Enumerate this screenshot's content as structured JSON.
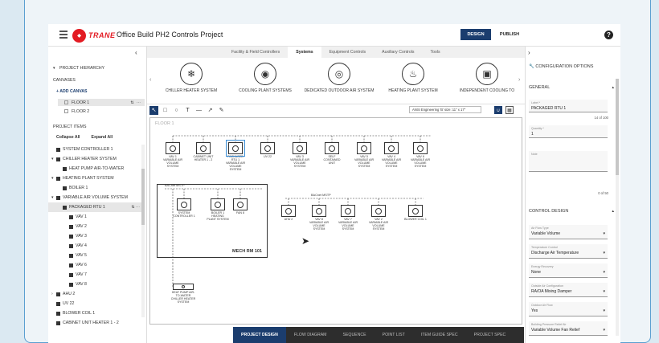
{
  "topbar": {
    "brand": "TRANE",
    "project_title": "Office Build PH2 Controls Project",
    "design_label": "DESIGN",
    "publish_label": "PUBLISH",
    "help_glyph": "?"
  },
  "left": {
    "hierarchy_title": "PROJECT HIERARCHY",
    "canvases_title": "CANVASES",
    "add_canvas": "+ ADD CANVAS",
    "canvases": [
      "FLOOR 1",
      "FLOOR 2"
    ],
    "project_items_title": "PROJECT ITEMS",
    "collapse_all": "Collapse All",
    "expand_all": "Expand All",
    "tree": [
      {
        "label": "SYSTEM CONTROLLER 1",
        "level": 1,
        "toggle": ""
      },
      {
        "label": "CHILLER HEATER SYSTEM",
        "level": 1,
        "toggle": "▾"
      },
      {
        "label": "HEAT PUMP AIR-TO-WATER",
        "level": 2,
        "toggle": ""
      },
      {
        "label": "HEATING PLANT SYSTEM",
        "level": 1,
        "toggle": "▾"
      },
      {
        "label": "BOILER 1",
        "level": 2,
        "toggle": ""
      },
      {
        "label": "VARIABLE AIR VOLUME SYSTEM",
        "level": 1,
        "toggle": "▾"
      },
      {
        "label": "PACKAGED RTU 1",
        "level": 2,
        "toggle": "",
        "selected": true
      },
      {
        "label": "VAV 1",
        "level": 3,
        "toggle": ""
      },
      {
        "label": "VAV 2",
        "level": 3,
        "toggle": ""
      },
      {
        "label": "VAV 3",
        "level": 3,
        "toggle": ""
      },
      {
        "label": "VAV 4",
        "level": 3,
        "toggle": ""
      },
      {
        "label": "VAV 5",
        "level": 3,
        "toggle": ""
      },
      {
        "label": "VAV 6",
        "level": 3,
        "toggle": ""
      },
      {
        "label": "VAV 7",
        "level": 3,
        "toggle": ""
      },
      {
        "label": "VAV 8",
        "level": 3,
        "toggle": ""
      },
      {
        "label": "AHU 2",
        "level": 1,
        "toggle": "›"
      },
      {
        "label": "UV 22",
        "level": 1,
        "toggle": ""
      },
      {
        "label": "BLOWER COIL 1",
        "level": 1,
        "toggle": ""
      },
      {
        "label": "CABINET UNIT HEATER 1 - 2",
        "level": 1,
        "toggle": ""
      }
    ]
  },
  "center": {
    "tabs": [
      {
        "label": "Facility & Field Controllers",
        "active": false
      },
      {
        "label": "Systems",
        "active": true
      },
      {
        "label": "Equipment Controls",
        "active": false
      },
      {
        "label": "Auxiliary Controls",
        "active": false
      },
      {
        "label": "Tools",
        "active": false
      }
    ],
    "catalog": [
      {
        "label": "CHILLER HEATER SYSTEM",
        "glyph": "❄"
      },
      {
        "label": "COOLING PLANT SYSTEMS",
        "glyph": "◉"
      },
      {
        "label": "DEDICATED OUTDOOR AIR SYSTEM",
        "glyph": "◎"
      },
      {
        "label": "HEATING PLANT SYSTEM",
        "glyph": "♨"
      },
      {
        "label": "INDEPENDENT COOLING TO",
        "glyph": "▣"
      }
    ],
    "scale_select": "ANSI Engineering 'B' size: 11\" x 17\"",
    "floor_label": "FLOOR 1",
    "top_row_devices": [
      {
        "label": "VAV 1\nVARIABLE AIR VOLUME SYSTEM"
      },
      {
        "label": "CABINET UNIT HEATER 1 - 2"
      },
      {
        "label": "PACKAGED RTU 1\nVARIABLE AIR VOLUME SYSTEM",
        "selected": true
      },
      {
        "label": "UV 22"
      },
      {
        "label": "VAV 3\nVARIABLE AIR VOLUME SYSTEM"
      },
      {
        "label": "SELF CONTAINED UNIT"
      },
      {
        "label": "VAV 5\nVARIABLE AIR VOLUME SYSTEM"
      },
      {
        "label": "VAV 4\nVARIABLE AIR VOLUME SYSTEM"
      },
      {
        "label": "VAV 6\nVARIABLE AIR VOLUME SYSTEM"
      }
    ],
    "mech_devices": [
      {
        "label": "SYSTEM CONTROLLER 1"
      },
      {
        "label": "BOILER 1\nHEATING PLANT SYSTEM"
      },
      {
        "label": "FAN 8"
      }
    ],
    "mid_row_devices": [
      {
        "label": "AHU 2"
      },
      {
        "label": "VAV 8\nVARIABLE AIR VOLUME SYSTEM"
      },
      {
        "label": "VAV 7\nVARIABLE AIR VOLUME SYSTEM"
      },
      {
        "label": "VAV 2\nVARIABLE AIR VOLUME SYSTEM"
      },
      {
        "label": "BLOWER COIL 1"
      }
    ],
    "heat_pump": "HEAT PUMP AIR-TO-WATER\nCHILLER HEATER SYSTEM",
    "mech_room": "MECH RM 101",
    "bacnet_1": "BACnet MSTP",
    "bacnet_2": "BACnet MSTP",
    "bottom_tabs": [
      {
        "label": "PROJECT DESIGN",
        "active": true
      },
      {
        "label": "FLOW DIAGRAM",
        "active": false
      },
      {
        "label": "SEQUENCE",
        "active": false
      },
      {
        "label": "POINT LIST",
        "active": false
      },
      {
        "label": "ITEM GUIDE SPEC",
        "active": false
      },
      {
        "label": "PROJECT SPEC",
        "active": false
      }
    ]
  },
  "right": {
    "title": "CONFIGURATION OPTIONS",
    "general": "GENERAL",
    "label_field": {
      "label": "Label *",
      "value": "PACKAGED RTU 1",
      "count": "14 of 100"
    },
    "quantity_field": {
      "label": "Quantity *",
      "value": "1"
    },
    "note_field": {
      "label": "Note",
      "value": "",
      "count": "0 of 50"
    },
    "control_design": "CONTROL DESIGN",
    "selects": [
      {
        "label": "Air Flow Type",
        "value": "Variable Volume"
      },
      {
        "label": "Temperature Control",
        "value": "Discharge Air Temperature"
      },
      {
        "label": "Energy Recovery",
        "value": "None"
      },
      {
        "label": "Outside Air Configuration",
        "value": "RA/OA Mixing Damper"
      },
      {
        "label": "Outdoor Air Flow",
        "value": "Yes"
      },
      {
        "label": "Building Pressure Relief Air",
        "value": "Variable Volume Fan Relief"
      }
    ]
  },
  "colors": {
    "accent": "#1b3d6e",
    "brand": "#e31b23",
    "selection": "#3d8fd6"
  }
}
